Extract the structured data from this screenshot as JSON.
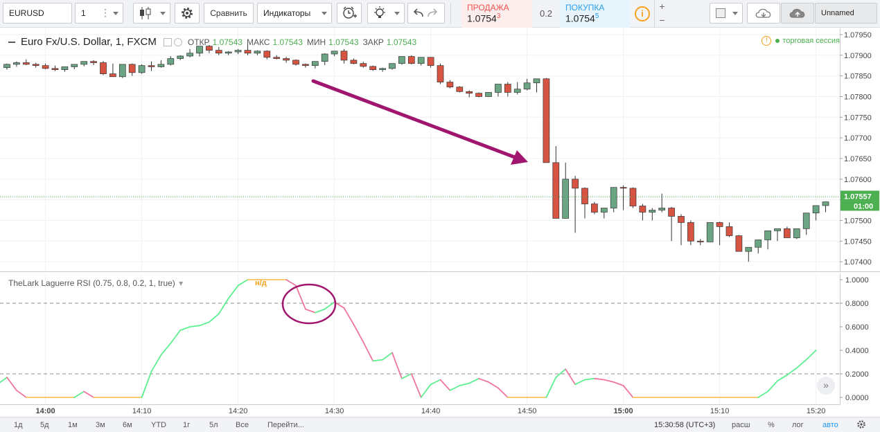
{
  "toolbar": {
    "symbol": "EURUSD",
    "interval": "1",
    "compare_label": "Сравнить",
    "indicators_label": "Индикаторы",
    "sell_label": "ПРОДАЖА",
    "sell_price": "1.0754",
    "sell_sup": "3",
    "spread": "0.2",
    "buy_label": "ПОКУПКА",
    "buy_price": "1.0754",
    "buy_sup": "5",
    "plus": "+",
    "minus": "−",
    "layout_name": "Unnamed",
    "icons": [
      "chart-type-candles-icon",
      "settings-gear-icon",
      "alert-clock-icon",
      "ideas-bulb-icon",
      "undo-icon",
      "redo-icon",
      "info-icon",
      "layout-square-icon",
      "cloud-download-icon",
      "cloud-upload-icon"
    ]
  },
  "legend": {
    "title": "Euro Fx/U.S. Dollar, 1, FXCM",
    "open_label": "ОТКР",
    "open": "1.07543",
    "high_label": "МАКС",
    "high": "1.07543",
    "low_label": "МИН",
    "low": "1.07543",
    "close_label": "ЗАКР",
    "close": "1.07543",
    "session": "торговая сессия"
  },
  "rsi_legend": {
    "title": "TheLark Laguerre RSI (0.75, 0.8, 0.2, 1, true)",
    "na": "н/д"
  },
  "price_axis": {
    "labels": [
      "1.07950",
      "1.07900",
      "1.07850",
      "1.07800",
      "1.07750",
      "1.07700",
      "1.07650",
      "1.07600",
      "1.07550",
      "1.07500",
      "1.07450",
      "1.07400"
    ],
    "current_price": "1.07557",
    "countdown": "01:00"
  },
  "rsi_axis": {
    "labels": [
      "1.0000",
      "0.8000",
      "0.6000",
      "0.4000",
      "0.2000",
      "0.0000"
    ]
  },
  "time_axis": {
    "labels": [
      {
        "t": "14:00",
        "bold": true
      },
      {
        "t": "14:10",
        "bold": false
      },
      {
        "t": "14:20",
        "bold": false
      },
      {
        "t": "14:30",
        "bold": false
      },
      {
        "t": "14:40",
        "bold": false
      },
      {
        "t": "14:50",
        "bold": false
      },
      {
        "t": "15:00",
        "bold": true
      },
      {
        "t": "15:10",
        "bold": false
      },
      {
        "t": "15:20",
        "bold": false
      }
    ]
  },
  "bottom": {
    "ranges": [
      "1д",
      "5д",
      "1м",
      "3м",
      "6м",
      "YTD",
      "1г",
      "5л",
      "Все"
    ],
    "goto": "Перейти...",
    "clock": "15:30:58 (UTC+3)",
    "ext": "расш",
    "percent": "%",
    "log": "лог",
    "auto": "авто"
  },
  "colors": {
    "up": "#6ba583",
    "down": "#d75442",
    "rsi_up": "#5cf08f",
    "rsi_down": "#f0759b",
    "rsi_flat": "#f7c25e",
    "annotation": "#a0166f",
    "last_price": "#4caf50"
  },
  "chart_data": [
    {
      "type": "candlestick",
      "title": "Euro Fx/U.S. Dollar, 1, FXCM",
      "x": [
        "13:56",
        "13:57",
        "13:58",
        "13:59",
        "14:00",
        "14:01",
        "14:02",
        "14:03",
        "14:04",
        "14:05",
        "14:06",
        "14:07",
        "14:08",
        "14:09",
        "14:10",
        "14:11",
        "14:12",
        "14:13",
        "14:14",
        "14:15",
        "14:16",
        "14:17",
        "14:18",
        "14:19",
        "14:20",
        "14:21",
        "14:22",
        "14:23",
        "14:24",
        "14:25",
        "14:26",
        "14:27",
        "14:28",
        "14:29",
        "14:30",
        "14:31",
        "14:32",
        "14:33",
        "14:34",
        "14:35",
        "14:36",
        "14:37",
        "14:38",
        "14:39",
        "14:40",
        "14:41",
        "14:42",
        "14:43",
        "14:44",
        "14:45",
        "14:46",
        "14:47",
        "14:48",
        "14:49",
        "14:50",
        "14:51",
        "14:52",
        "14:53",
        "14:54",
        "14:55",
        "14:56",
        "14:57",
        "14:58",
        "14:59",
        "15:00",
        "15:01",
        "15:02",
        "15:03",
        "15:04",
        "15:05",
        "15:06",
        "15:07",
        "15:08",
        "15:09",
        "15:10",
        "15:11",
        "15:12",
        "15:13",
        "15:14",
        "15:15",
        "15:16",
        "15:17",
        "15:18",
        "15:19",
        "15:20",
        "15:21"
      ],
      "open": [
        1.0787,
        1.07878,
        1.07882,
        1.07878,
        1.07875,
        1.07868,
        1.07865,
        1.07872,
        1.07878,
        1.07885,
        1.07882,
        1.07855,
        1.07848,
        1.07878,
        1.07858,
        1.07875,
        1.07872,
        1.07878,
        1.07892,
        1.07898,
        1.07905,
        1.07922,
        1.07912,
        1.07905,
        1.07908,
        1.07912,
        1.07905,
        1.0791,
        1.07895,
        1.07892,
        1.07888,
        1.07878,
        1.07875,
        1.07885,
        1.07903,
        1.0791,
        1.07888,
        1.0788,
        1.07873,
        1.07865,
        1.07868,
        1.0788,
        1.07897,
        1.0788,
        1.07895,
        1.07875,
        1.07835,
        1.07823,
        1.07812,
        1.07808,
        1.078,
        1.0781,
        1.0783,
        1.0781,
        1.07818,
        1.07833,
        1.07843,
        1.0764,
        1.07505,
        1.076,
        1.07578,
        1.0754,
        1.0752,
        1.0753,
        1.0758,
        1.07578,
        1.07535,
        1.0752,
        1.07525,
        1.0753,
        1.0751,
        1.07495,
        1.0745,
        1.07448,
        1.07495,
        1.07485,
        1.07463,
        1.07425,
        1.07435,
        1.07453,
        1.07475,
        1.0748,
        1.07458,
        1.0748,
        1.07518,
        1.07536,
        1.07545
      ],
      "high": [
        1.0788,
        1.07885,
        1.0789,
        1.07882,
        1.0788,
        1.07875,
        1.0787,
        1.07876,
        1.07882,
        1.07888,
        1.07886,
        1.0788,
        1.0786,
        1.0788,
        1.07878,
        1.07885,
        1.07888,
        1.07898,
        1.079,
        1.07915,
        1.0791,
        1.07925,
        1.0792,
        1.0791,
        1.07915,
        1.07925,
        1.07912,
        1.07912,
        1.079,
        1.07896,
        1.0789,
        1.0788,
        1.0788,
        1.07905,
        1.07908,
        1.07915,
        1.07892,
        1.07884,
        1.07875,
        1.0787,
        1.07872,
        1.0789,
        1.079,
        1.07888,
        1.07895,
        1.0788,
        1.0784,
        1.07825,
        1.07815,
        1.0781,
        1.07805,
        1.07818,
        1.07835,
        1.07835,
        1.07843,
        1.07835,
        1.07845,
        1.0768,
        1.0764,
        1.07608,
        1.0758,
        1.07545,
        1.07525,
        1.0754,
        1.07585,
        1.0758,
        1.0754,
        1.0753,
        1.07565,
        1.07533,
        1.07515,
        1.075,
        1.07455,
        1.0746,
        1.07497,
        1.07495,
        1.07465,
        1.0743,
        1.0744,
        1.07458,
        1.0748,
        1.07485,
        1.0746,
        1.07485,
        1.0752,
        1.07545,
        1.07555
      ],
      "low": [
        1.07865,
        1.07872,
        1.07876,
        1.0787,
        1.07866,
        1.07862,
        1.0786,
        1.07866,
        1.07873,
        1.07876,
        1.07852,
        1.07848,
        1.07845,
        1.0785,
        1.07855,
        1.07862,
        1.0787,
        1.07875,
        1.07888,
        1.07895,
        1.07897,
        1.07905,
        1.079,
        1.079,
        1.07903,
        1.079,
        1.079,
        1.0789,
        1.0789,
        1.07882,
        1.07875,
        1.0787,
        1.07868,
        1.07876,
        1.07898,
        1.0788,
        1.07878,
        1.0787,
        1.07862,
        1.0786,
        1.07865,
        1.07877,
        1.07878,
        1.07875,
        1.0787,
        1.0783,
        1.0782,
        1.0781,
        1.07798,
        1.07798,
        1.078,
        1.078,
        1.078,
        1.07805,
        1.07815,
        1.0781,
        1.0764,
        1.07505,
        1.07505,
        1.0747,
        1.07505,
        1.07515,
        1.07505,
        1.0752,
        1.07525,
        1.0753,
        1.075,
        1.075,
        1.0752,
        1.0745,
        1.0744,
        1.0744,
        1.0744,
        1.07448,
        1.0744,
        1.0746,
        1.07425,
        1.074,
        1.0742,
        1.0743,
        1.0745,
        1.0747,
        1.07455,
        1.07465,
        1.075,
        1.0752,
        1.07537
      ],
      "close": [
        1.07878,
        1.07882,
        1.07878,
        1.07875,
        1.07868,
        1.07865,
        1.07872,
        1.07878,
        1.07885,
        1.07882,
        1.07855,
        1.07848,
        1.07878,
        1.07858,
        1.07875,
        1.07872,
        1.07878,
        1.07892,
        1.07898,
        1.07905,
        1.07922,
        1.07912,
        1.07905,
        1.07908,
        1.07912,
        1.07905,
        1.0791,
        1.07895,
        1.07892,
        1.07888,
        1.07878,
        1.07875,
        1.07885,
        1.07903,
        1.0791,
        1.07888,
        1.0788,
        1.07873,
        1.07865,
        1.07868,
        1.0788,
        1.07897,
        1.0788,
        1.07895,
        1.07875,
        1.07835,
        1.07823,
        1.07812,
        1.07808,
        1.078,
        1.0781,
        1.0783,
        1.0781,
        1.07818,
        1.07833,
        1.07843,
        1.0764,
        1.07505,
        1.076,
        1.07578,
        1.0754,
        1.0752,
        1.0753,
        1.0758,
        1.07578,
        1.07535,
        1.0752,
        1.07525,
        1.0753,
        1.0751,
        1.07495,
        1.0745,
        1.07448,
        1.07495,
        1.07485,
        1.07463,
        1.07425,
        1.07435,
        1.07453,
        1.07475,
        1.0748,
        1.07458,
        1.0748,
        1.07518,
        1.07536,
        1.07545,
        1.07557
      ],
      "ylim": [
        1.07375,
        1.07965
      ]
    },
    {
      "type": "line",
      "title": "TheLark Laguerre RSI (0.75, 0.8, 0.2, 1, true)",
      "x_range": [
        "13:55",
        "15:21"
      ],
      "values": [
        0.11,
        0.17,
        0.06,
        0.0,
        0.0,
        0.0,
        0.0,
        0.0,
        0.0,
        0.05,
        0.0,
        0.0,
        0.0,
        0.0,
        0.0,
        0.0,
        0.22,
        0.36,
        0.46,
        0.57,
        0.6,
        0.61,
        0.64,
        0.71,
        0.84,
        0.95,
        1.0,
        1.0,
        1.0,
        1.0,
        1.0,
        0.95,
        0.75,
        0.72,
        0.75,
        0.81,
        0.76,
        0.62,
        0.47,
        0.31,
        0.32,
        0.38,
        0.16,
        0.2,
        0.0,
        0.11,
        0.15,
        0.06,
        0.1,
        0.12,
        0.16,
        0.13,
        0.08,
        0.0,
        0.0,
        0.0,
        0.0,
        0.0,
        0.17,
        0.24,
        0.11,
        0.15,
        0.16,
        0.15,
        0.13,
        0.1,
        0.0,
        0.0,
        0.0,
        0.0,
        0.0,
        0.0,
        0.0,
        0.0,
        0.0,
        0.0,
        0.0,
        0.0,
        0.0,
        0.0,
        0.05,
        0.14,
        0.19,
        0.25,
        0.32,
        0.4
      ],
      "levels": [
        0.8,
        0.2
      ],
      "ylim": [
        0,
        1.0
      ]
    }
  ]
}
